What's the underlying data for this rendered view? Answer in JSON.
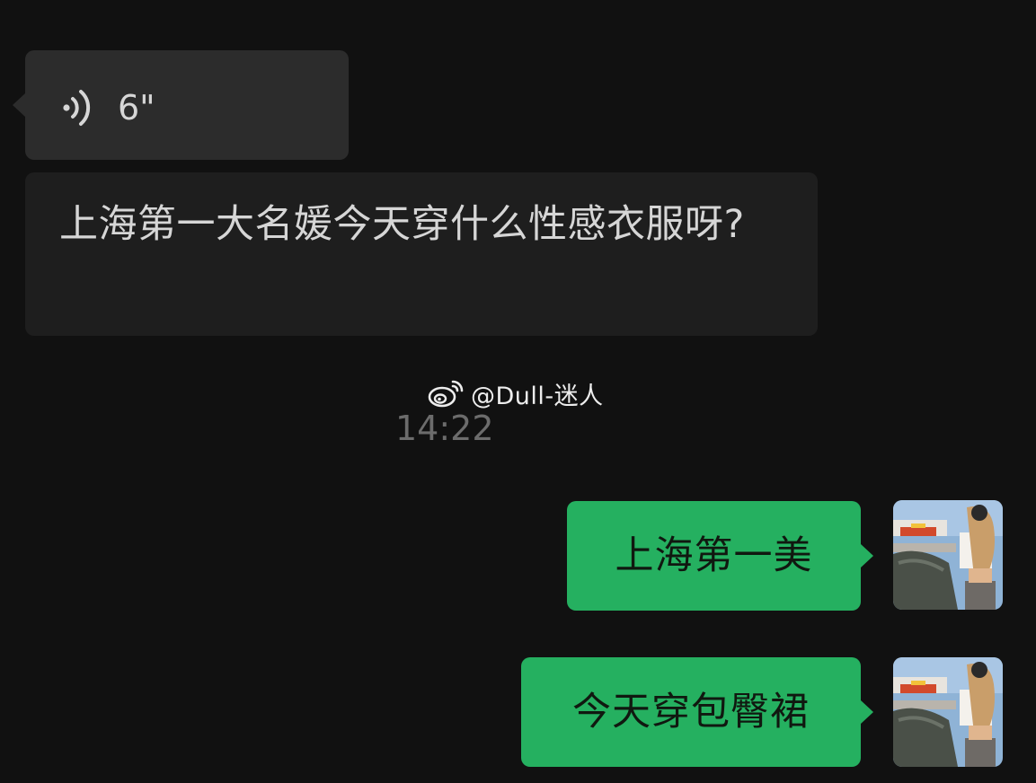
{
  "chat": {
    "incoming_voice": {
      "duration": "6\"",
      "icon": "voice-wave-icon"
    },
    "incoming_text": "上海第一大名媛今天穿什么性感衣服呀?",
    "timestamp": "14:22",
    "outgoing": [
      {
        "text": "上海第一美"
      },
      {
        "text": "今天穿包臀裙"
      }
    ]
  },
  "watermark": {
    "text": "@Dull-迷人",
    "icon": "weibo-icon"
  },
  "colors": {
    "background": "#111111",
    "incoming_bubble": "#2c2c2c",
    "incoming_text_bubble": "#1e1e1e",
    "outgoing_bubble": "#25b060",
    "timestamp": "#6c6c6c"
  }
}
